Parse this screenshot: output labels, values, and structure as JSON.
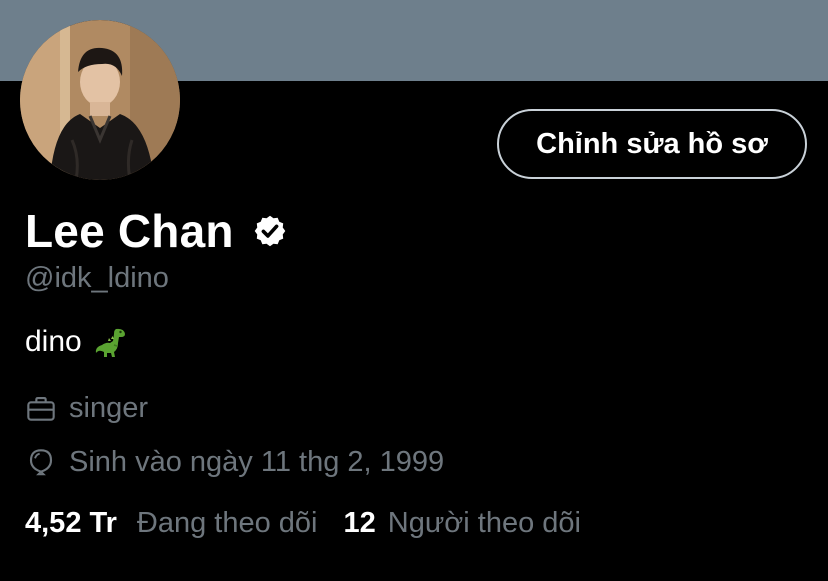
{
  "banner": {
    "color": "#6e7f8c"
  },
  "profile": {
    "name": "Lee Chan",
    "handle": "@idk_ldino",
    "bio_text": "dino",
    "bio_emoji": "dinosaur-emoji",
    "verified_icon": "verified-badge-icon"
  },
  "actions": {
    "edit_profile_label": "Chỉnh sửa hồ sơ"
  },
  "meta": {
    "profession_icon": "briefcase-icon",
    "profession": "singer",
    "birthday_icon": "balloon-icon",
    "birthday": "Sinh vào ngày 11 thg 2, 1999"
  },
  "stats": {
    "following_count": "4,52 Tr",
    "following_label": "Đang theo dõi",
    "followers_count": "12",
    "followers_label": "Người theo dõi"
  },
  "colors": {
    "background": "#000000",
    "primary_text": "#ffffff",
    "secondary_text": "#6e767d",
    "button_border": "#c9d1d8"
  }
}
